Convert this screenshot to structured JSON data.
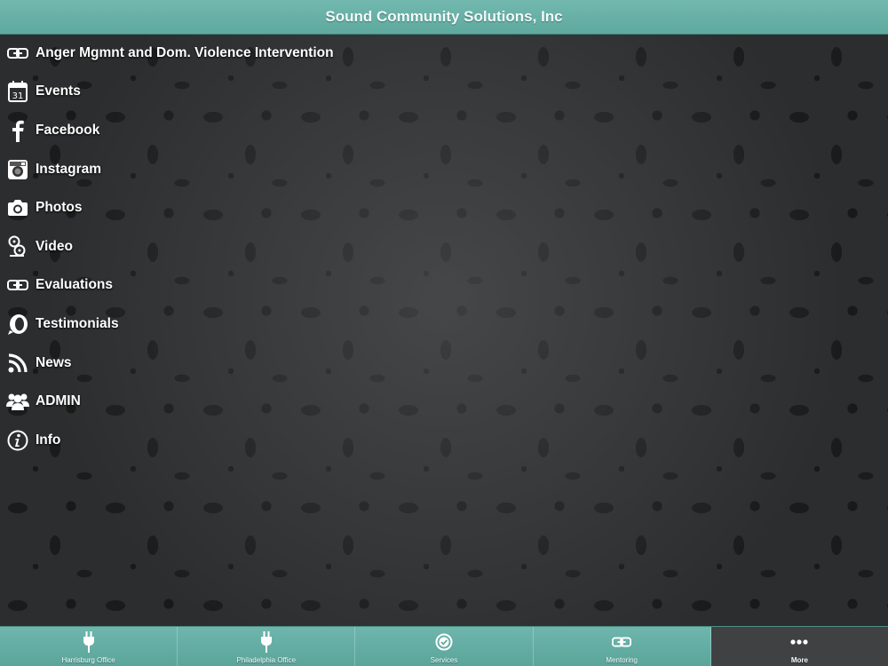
{
  "header": {
    "title": "Sound Community Solutions, Inc"
  },
  "menu": {
    "items": [
      {
        "label": "Anger Mgmnt and Dom. Violence Intervention",
        "icon": "link-icon"
      },
      {
        "label": "Events",
        "icon": "calendar-icon",
        "icon_text": "31"
      },
      {
        "label": "Facebook",
        "icon": "facebook-icon"
      },
      {
        "label": "Instagram",
        "icon": "instagram-icon"
      },
      {
        "label": "Photos",
        "icon": "camera-icon"
      },
      {
        "label": "Video",
        "icon": "film-icon"
      },
      {
        "label": "Evaluations",
        "icon": "link-icon"
      },
      {
        "label": "Testimonials",
        "icon": "quote-icon"
      },
      {
        "label": "News",
        "icon": "rss-icon"
      },
      {
        "label": "ADMIN",
        "icon": "users-icon"
      },
      {
        "label": "Info",
        "icon": "info-icon"
      }
    ]
  },
  "tabbar": {
    "tabs": [
      {
        "label": "Harrisburg Office",
        "icon": "plug-icon"
      },
      {
        "label": "Philadelphia Office",
        "icon": "plug-icon"
      },
      {
        "label": "Services",
        "icon": "check-circle-icon"
      },
      {
        "label": "Mentoring",
        "icon": "link-icon"
      },
      {
        "label": "More",
        "icon": "more-dots-icon",
        "active": true
      }
    ]
  },
  "colors": {
    "header_bg": "#6bb2a9",
    "tabbar_bg": "#62ada3",
    "active_tab_bg": "#3f4142",
    "background": "#2c2d2e"
  }
}
